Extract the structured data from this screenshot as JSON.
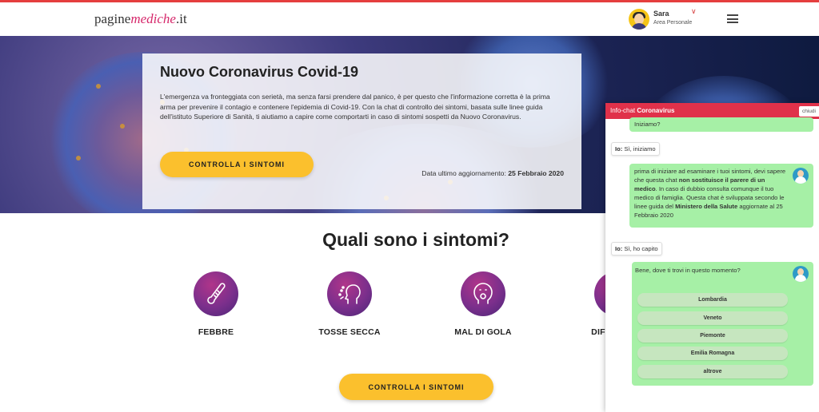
{
  "header": {
    "logo_part1": "pagine",
    "logo_part2": "mediche",
    "logo_part3": ".it",
    "user_name": "Sara",
    "user_subtitle": "Area Personale"
  },
  "hero": {
    "title": "Nuovo Coronavirus Covid-19",
    "text": "L'emergenza va fronteggiata con serietà, ma senza farsi prendere dal panico, è per questo che l'informazione corretta è la prima arma per prevenire il contagio e contenere l'epidemia di Covid-19. Con la chat di controllo dei sintomi, basata sulle linee guida dell'istituto Superiore di Sanità, ti aiutiamo a capire come comportarti in caso di sintomi sospetti da Nuovo Coronavirus.",
    "button_label": "CONTROLLA I SINTOMI",
    "date_label": "Data ultimo aggiornamento:",
    "date_value": "25 Febbraio 2020"
  },
  "symptoms": {
    "title": "Quali sono i sintomi?",
    "items": [
      {
        "label": "FEBBRE",
        "icon": "thermometer-icon"
      },
      {
        "label": "TOSSE SECCA",
        "icon": "cough-icon"
      },
      {
        "label": "MAL DI GOLA",
        "icon": "sore-throat-icon"
      },
      {
        "label": "DIFFICOLTÀ",
        "icon": "breathing-icon"
      }
    ],
    "button_label": "CONTROLLA I SINTOMI"
  },
  "chat": {
    "title_prefix": "Info-chat",
    "title_bold": "Coronavirus",
    "close_label": "chiudi",
    "msg1": "Iniziamo?",
    "user1_prefix": "Io:",
    "user1_text": "Sì, iniziamo",
    "msg2_part1": "prima di iniziare ad esaminare i tuoi sintomi, devi sapere che questa chat",
    "msg2_bold1": "non sostituisce il parere di un medico",
    "msg2_part2": ". In caso di dubbio consulta comunque il tuo medico di famiglia. Questa chat è sviluppata secondo le linee guida del",
    "msg2_bold2": "Ministero della Salute",
    "msg2_part3": "aggiornate al 25 Febbraio 2020",
    "user2_prefix": "Io:",
    "user2_text": "Sì, ho capito",
    "msg3": "Bene, dove ti trovi in questo momento?",
    "options": [
      "Lombardia",
      "Veneto",
      "Piemonte",
      "Emilia Romagna",
      "altrove"
    ]
  },
  "colors": {
    "accent_red": "#e0314a",
    "button_yellow": "#fbc02d",
    "bubble_green": "#a6f0a6",
    "symptom_purple": "#7b2f8c"
  }
}
